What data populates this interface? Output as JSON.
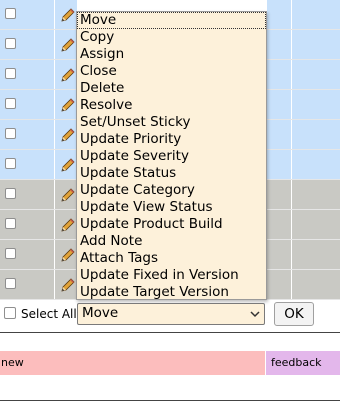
{
  "rows": [
    {
      "color": "blue"
    },
    {
      "color": "blue"
    },
    {
      "color": "blue"
    },
    {
      "color": "blue"
    },
    {
      "color": "blue"
    },
    {
      "color": "blue"
    },
    {
      "color": "gray"
    },
    {
      "color": "gray"
    },
    {
      "color": "gray"
    },
    {
      "color": "gray"
    }
  ],
  "row_icons": {
    "edit": "pencil-icon",
    "checkbox": "checkbox"
  },
  "dropdown": {
    "items": [
      "Move",
      "Copy",
      "Assign",
      "Close",
      "Delete",
      "Resolve",
      "Set/Unset Sticky",
      "Update Priority",
      "Update Severity",
      "Update Status",
      "Update Category",
      "Update View Status",
      "Update Product Build",
      "Add Note",
      "Attach Tags",
      "Update Fixed in Version",
      "Update Target Version"
    ],
    "selected_index": 0
  },
  "footer": {
    "select_all_label": "Select All",
    "action_select_value": "Move",
    "ok_label": "OK"
  },
  "legend": {
    "new_label": "new",
    "feedback_label": "feedback"
  },
  "colors": {
    "row_blue": "#c8e1fb",
    "row_gray": "#c9c9c4",
    "dropdown_bg": "#fdf1da",
    "status_new": "#fcbdbd",
    "status_feedback": "#e3b7eb"
  }
}
